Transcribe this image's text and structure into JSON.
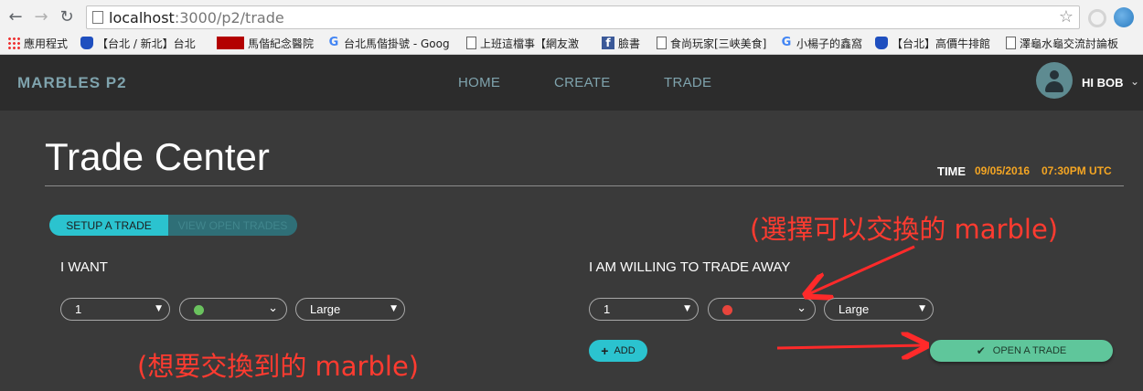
{
  "browser": {
    "url_host": "localhost",
    "url_path": ":3000/p2/trade",
    "bookmarks": [
      "應用程式",
      "【台北 / 新北】台北",
      "馬偕紀念醫院",
      "台北馬偕掛號 - Goog",
      "上班這檔事【網友激",
      "臉書",
      "食尚玩家[三峽美食]",
      "小楊子的鑫窩",
      "【台北】高價牛排館",
      "澤龜水龜交流討論板"
    ]
  },
  "app": {
    "brand": "MARBLES P2",
    "nav": [
      "HOME",
      "CREATE",
      "TRADE"
    ],
    "greeting": "HI BOB"
  },
  "main": {
    "title": "Trade Center",
    "time_label": "TIME",
    "time_date": "09/05/2016",
    "time_hour": "07:30PM UTC",
    "tabs": [
      "SETUP A TRADE",
      "VIEW OPEN TRADES"
    ],
    "want": {
      "label": "I WANT",
      "qty": "1",
      "color": "#6ac25e",
      "size": "Large"
    },
    "give": {
      "label": "I AM WILLING TO TRADE AWAY",
      "qty": "1",
      "color": "#e8453c",
      "size": "Large"
    },
    "add_label": "ADD",
    "open_trade_label": "OPEN A TRADE"
  },
  "annotations": {
    "top": "(選擇可以交換的 marble)",
    "bottom": "(想要交換到的 marble)"
  }
}
